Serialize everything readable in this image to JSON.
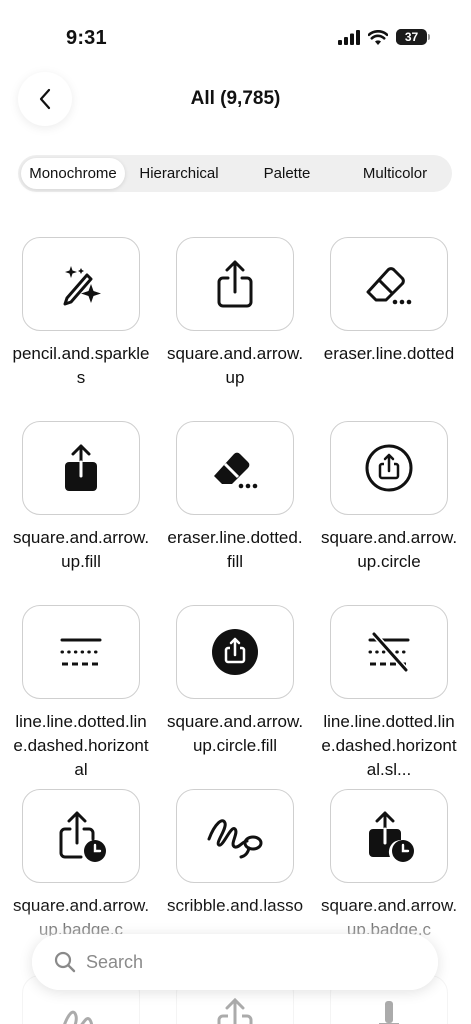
{
  "status_bar": {
    "time": "9:31",
    "battery_level": "37"
  },
  "nav": {
    "title": "All (9,785)"
  },
  "segments": [
    {
      "label": "Monochrome",
      "active": true
    },
    {
      "label": "Hierarchical",
      "active": false
    },
    {
      "label": "Palette",
      "active": false
    },
    {
      "label": "Multicolor",
      "active": false
    }
  ],
  "symbols": [
    {
      "label": "pencil.and.sparkles",
      "icon": "pencil-and-sparkles-icon"
    },
    {
      "label": "square.and.arrow.up",
      "icon": "square-and-arrow-up-icon"
    },
    {
      "label": "eraser.line.dotted",
      "icon": "eraser-line-dotted-icon"
    },
    {
      "label": "square.and.arrow.up.fill",
      "icon": "square-and-arrow-up-fill-icon"
    },
    {
      "label": "eraser.line.dotted.fill",
      "icon": "eraser-line-dotted-fill-icon"
    },
    {
      "label": "square.and.arrow.up.circle",
      "icon": "square-and-arrow-up-circle-icon"
    },
    {
      "label": "line.line.dotted.line.dashed.horizontal",
      "icon": "line-dotted-dashed-horizontal-icon"
    },
    {
      "label": "square.and.arrow.up.circle.fill",
      "icon": "square-and-arrow-up-circle-fill-icon"
    },
    {
      "label": "line.line.dotted.line.dashed.horizontal.sl...",
      "icon": "line-dotted-dashed-horizontal-slash-icon"
    },
    {
      "label": "square.and.arrow.up.badge.c",
      "icon": "square-and-arrow-up-badge-clock-icon"
    },
    {
      "label": "scribble.and.lasso",
      "icon": "scribble-and-lasso-icon"
    },
    {
      "label": "square.and.arrow.up.badge.c",
      "icon": "square-and-arrow-up-badge-clock-fill-icon"
    }
  ],
  "search": {
    "placeholder": "Search"
  }
}
